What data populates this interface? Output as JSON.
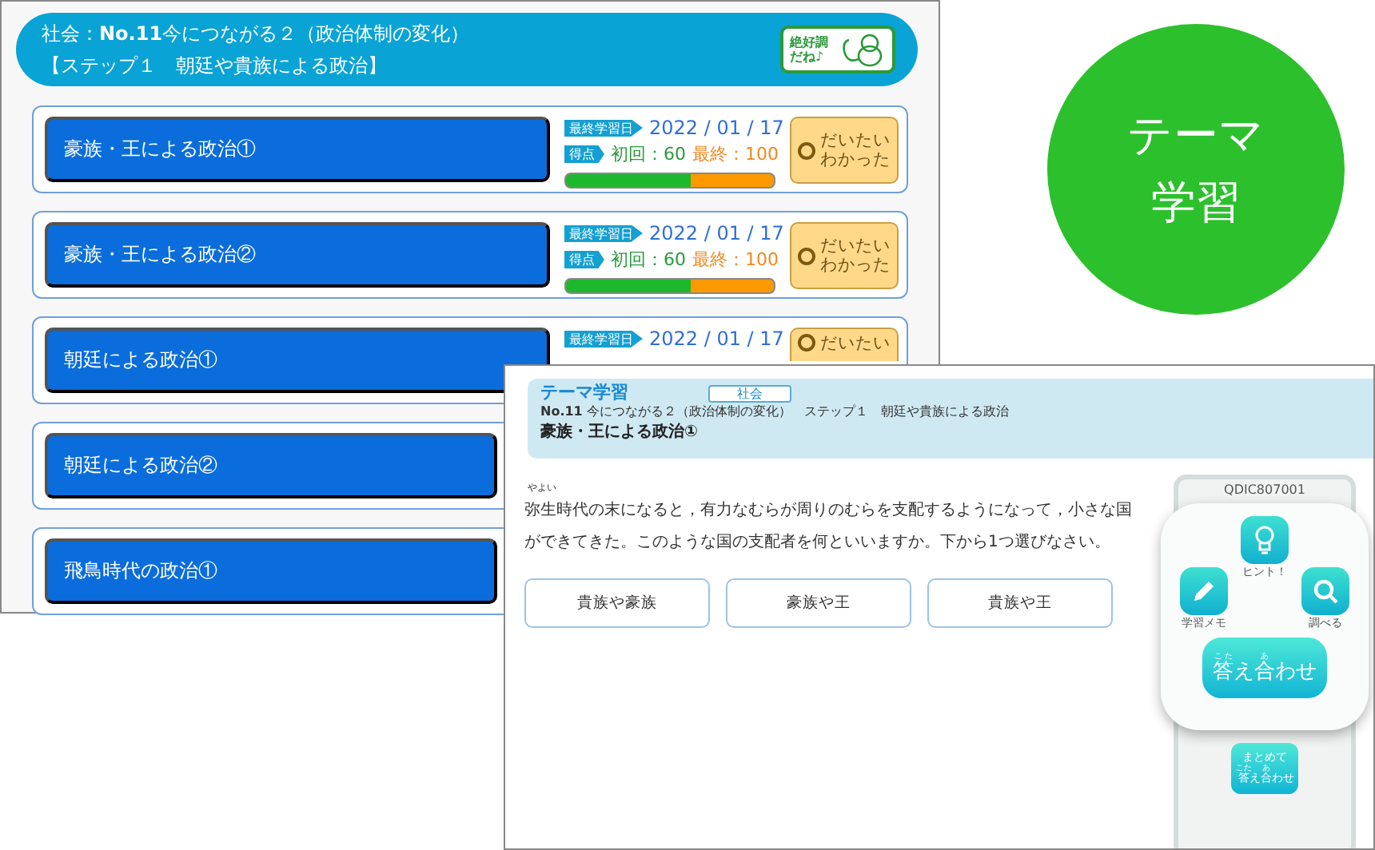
{
  "back_screen": {
    "header": {
      "title": "社会：**No.11**今につながる２（政治体制の変化）",
      "step": "【ステップ１　朝廷や貴族による政治】",
      "stamp": [
        "絶好調",
        "だね♪"
      ]
    },
    "lessons": [
      {
        "title": "豪族・王による政治①",
        "date_label": "最終学習日",
        "date": "2022 / 01 / 17",
        "score_label": "得点",
        "first": "初回：60",
        "final": "最終：100",
        "bar": {
          "level": 0.6
        },
        "button": [
          "だいたい",
          "わかった"
        ]
      },
      {
        "title": "豪族・王による政治②",
        "date_label": "最終学習日",
        "date": "2022 / 01 / 17",
        "score_label": "得点",
        "first": "初回：60",
        "final": "最終：100",
        "bar": {
          "level": 0.6
        },
        "button": [
          "だいたい",
          "わかった"
        ]
      },
      {
        "title": "朝廷による政治①",
        "date_label": "最終学習日",
        "date": "2022 / 01 / 17",
        "button": [
          "だいたい"
        ]
      },
      {
        "title": "朝廷による政治②"
      },
      {
        "title": "飛鳥時代の政治①"
      }
    ]
  },
  "badge": {
    "lines": [
      "テーマ",
      "学習"
    ]
  },
  "front_screen": {
    "heading": "テーマ学習",
    "subject_tag": "社会",
    "breadcrumb": "**No.11** 今につながる２（政治体制の変化）　ステップ１　朝廷や貴族による政治",
    "lesson_title": "豪族・王による政治①",
    "question": {
      "reading": "やよい",
      "text": "弥生時代の末になると，有力なむらが周りのむらを支配するようになって，小さな国ができてきた。このような国の支配者を何といいますか。下から1つ選びなさい。"
    },
    "choices": [
      "貴族や豪族",
      "豪族や王",
      "貴族や王"
    ],
    "panel": {
      "code": "QDIC807001",
      "hint": "ヒント！",
      "memo": "学習メモ",
      "search": "調べる",
      "answer": [
        {
          "base": "答",
          "rt": "こた"
        },
        {
          "base": "え"
        },
        {
          "base": "合",
          "rt": "あ"
        },
        {
          "base": "わせ"
        }
      ],
      "answer_all_top": "まとめて",
      "answer_all": [
        {
          "base": "答",
          "rt": "こた"
        },
        {
          "base": "え"
        },
        {
          "base": "合",
          "rt": "あ"
        },
        {
          "base": "わせ"
        }
      ]
    }
  }
}
